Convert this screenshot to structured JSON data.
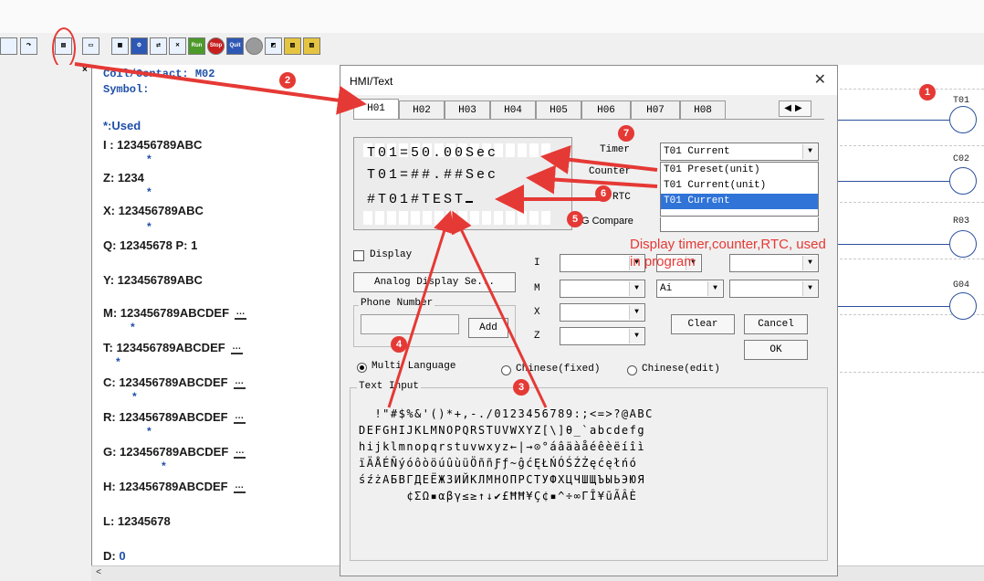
{
  "left_panel": {
    "header_coil": "Coil/Contact:",
    "header_coil_value": "M02",
    "header_symbol": "Symbol:",
    "used_label": "*:Used",
    "close_glyph": "×",
    "rows": [
      {
        "text": "I : 123456789ABC"
      },
      {
        "text": "Z: 1234"
      },
      {
        "text": "X: 123456789ABC"
      },
      {
        "text": "Q: 12345678  P: 1"
      },
      {
        "text": "Y: 123456789ABC"
      },
      {
        "text": "M: 123456789ABCDEF"
      },
      {
        "text": "T: 123456789ABCDEF"
      },
      {
        "text": "C: 123456789ABCDEF"
      },
      {
        "text": "R: 123456789ABCDEF"
      },
      {
        "text": "G: 123456789ABCDEF"
      },
      {
        "text": "H: 123456789ABCDEF"
      },
      {
        "text": "L: 12345678"
      },
      {
        "text": "D:"
      }
    ],
    "d_value": "0",
    "star": "*",
    "more_glyph": "…"
  },
  "toolbar": {
    "run_label": "Run",
    "stop_label": "Stop",
    "quit_label": "Quit"
  },
  "dialog": {
    "title": "HMI/Text",
    "close": "✕",
    "tabs": [
      "H01",
      "H02",
      "H03",
      "H04",
      "H05",
      "H06",
      "H07",
      "H08"
    ],
    "tab_arrows": "◀▶",
    "lcd_lines": [
      "T01=50.00Sec",
      "T01=##.##Sec",
      "#T01#TEST"
    ],
    "timer_label": "Timer",
    "counter_label": "Counter",
    "rtc_label": "RTC",
    "gcompare_label": "G Compare",
    "timer_select_value": "T01 Current",
    "timer_options": [
      "T01 Preset(unit)",
      "T01 Current(unit)",
      "T01 Current"
    ],
    "display_label": "Display",
    "analog_button": "Analog Display Se...",
    "phone_group": "Phone Number",
    "add_button": "Add",
    "row_labels": [
      "I",
      "M",
      "X",
      "Z"
    ],
    "m_select_2": "Ai",
    "clear_button": "Clear",
    "cancel_button": "Cancel",
    "ok_button": "OK",
    "multi_language": "Multi Language",
    "chinese_fixed": "Chinese(fixed)",
    "chinese_edit": "Chinese(edit)",
    "text_input_group": "Text Input",
    "char_rows": [
      "  !\"#$%&'()*+,-./0123456789:;<=>?@ABC",
      "DEFGHIJKLMNOPQRSTUVWXYZ[\\]θ_`abcdefg",
      "hijklmnopqrstuvwxyz←|→⊙°áâäàåéêèëíîì",
      "ïÄÅÉÑýóôòöúûùüÖññƑƒ~ĝćĘŁŃÓŚŹŻęćęłńó",
      "śźżАБВГДЕЁЖЗИЙКЛМНОПРСТУФХЦЧШЩЪЫЬЭЮЯ",
      "      ¢ΣΩ▪αβγ≤≥↑↓✔£ĦĦ¥Ç¢▪^÷∞ΓȊ¥ũÃÂÈ"
    ]
  },
  "annotation": {
    "text": "Display timer,counter,RTC, used in program",
    "badges": [
      "1",
      "2",
      "3",
      "4",
      "5",
      "6",
      "7"
    ],
    "color": "#e53935"
  },
  "ladder": {
    "coils": [
      "T01",
      "C02",
      "R03",
      "G04"
    ],
    "coil_color": "#2b4f9e"
  }
}
